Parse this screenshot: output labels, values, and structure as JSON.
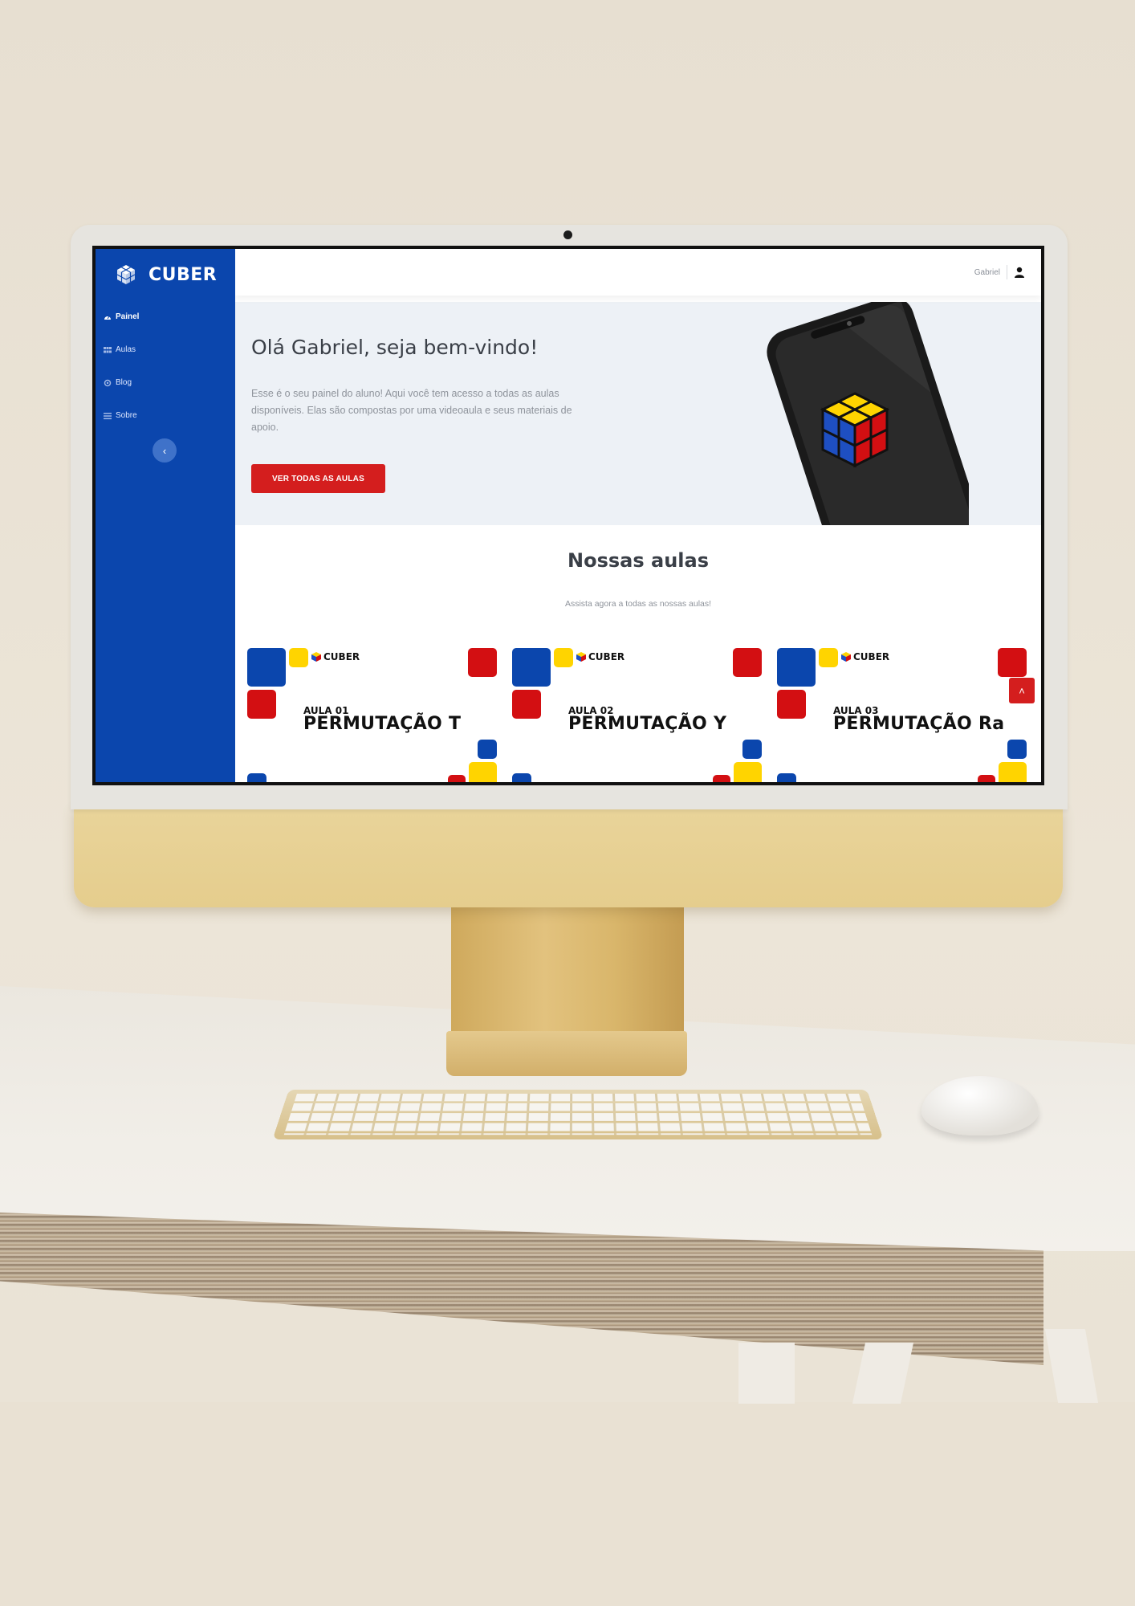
{
  "app": {
    "brand": "CUBER",
    "colors": {
      "primary": "#0b46ad",
      "accent": "#d41e1e",
      "yellow": "#ffd400",
      "hero_bg": "#edf1f6"
    }
  },
  "sidebar": {
    "items": [
      {
        "label": "Painel",
        "icon": "dashboard-icon",
        "active": true
      },
      {
        "label": "Aulas",
        "icon": "grid-icon",
        "active": false
      },
      {
        "label": "Blog",
        "icon": "gear-icon",
        "active": false
      },
      {
        "label": "Sobre",
        "icon": "list-icon",
        "active": false
      }
    ],
    "collapse_glyph": "‹"
  },
  "topbar": {
    "user_name": "Gabriel",
    "user_icon": "user-icon"
  },
  "hero": {
    "title": "Olá Gabriel, seja bem-vindo!",
    "text": "Esse é o seu painel do aluno! Aqui você tem acesso a todas as aulas disponíveis. Elas são compostas por uma videoaula e seus materiais de apoio.",
    "button": "VER TODAS AS AULAS"
  },
  "lessons": {
    "title": "Nossas aulas",
    "subtitle": "Assista agora a todas as nossas aulas!",
    "cards": [
      {
        "logo": "CUBER",
        "number": "AULA 01",
        "title": "PERMUTAÇÃO T"
      },
      {
        "logo": "CUBER",
        "number": "AULA 02",
        "title": "PERMUTAÇÃO Y"
      },
      {
        "logo": "CUBER",
        "number": "AULA 03",
        "title": "PERMUTAÇÃO Ra"
      }
    ]
  },
  "scroll_top_glyph": "˄"
}
